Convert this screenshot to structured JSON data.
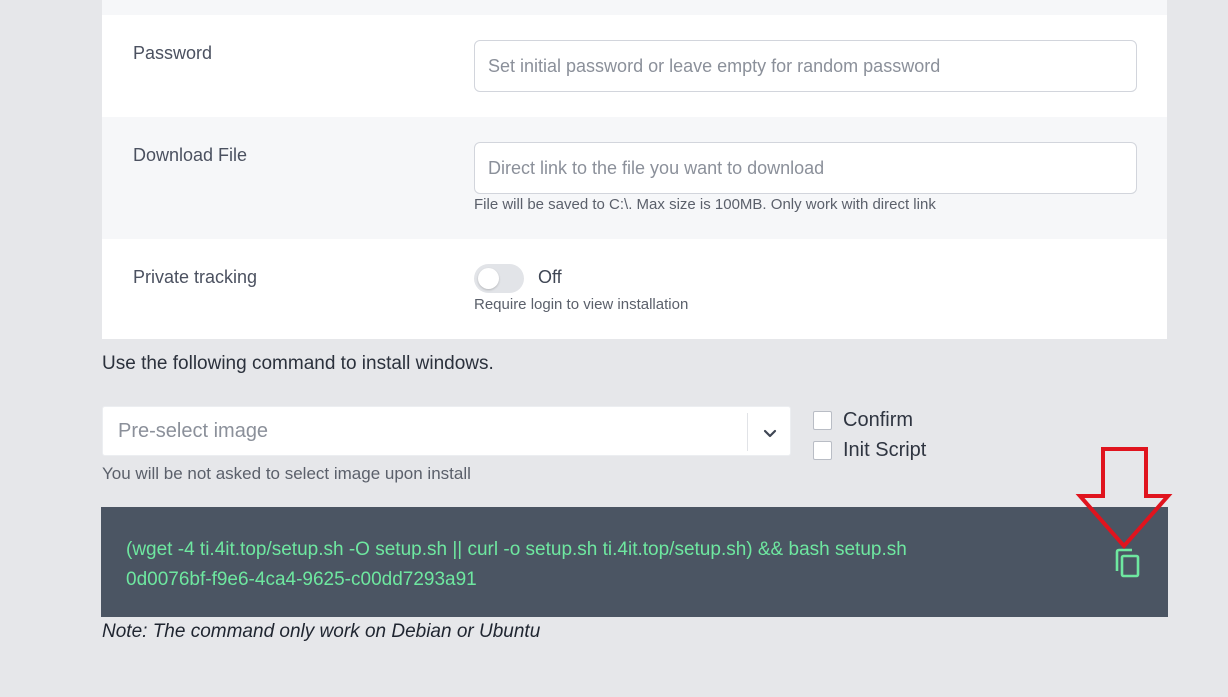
{
  "form": {
    "password": {
      "label": "Password",
      "value": "",
      "placeholder": "Set initial password or leave empty for random password"
    },
    "download_file": {
      "label": "Download File",
      "value": "",
      "placeholder": "Direct link to the file you want to download",
      "hint": "File will be saved to C:\\. Max size is 100MB. Only work with direct link"
    },
    "private_tracking": {
      "label": "Private tracking",
      "state": "Off",
      "enabled": false,
      "hint": "Require login to view installation"
    }
  },
  "install": {
    "instruction": "Use the following command to install windows.",
    "image_select": {
      "placeholder": "Pre-select image",
      "hint": "You will be not asked to select image upon install"
    },
    "options": [
      {
        "label": "Confirm",
        "checked": false
      },
      {
        "label": "Init Script",
        "checked": false
      }
    ],
    "command_line1": "(wget -4 ti.4it.top/setup.sh -O setup.sh || curl -o setup.sh ti.4it.top/setup.sh) && bash setup.sh",
    "command_line2": "0d0076bf-f9e6-4ca4-9625-c00dd7293a91",
    "note": "Note: The command only work on Debian or Ubuntu"
  },
  "icons": {
    "copy": "copy-icon",
    "chevron": "chevron-down-icon",
    "annotation": "red-arrow-down-icon"
  },
  "colors": {
    "page_bg": "#e6e7ea",
    "command_bg": "#4b5563",
    "command_text": "#6ee7a0",
    "annotation_red": "#e0141e"
  }
}
